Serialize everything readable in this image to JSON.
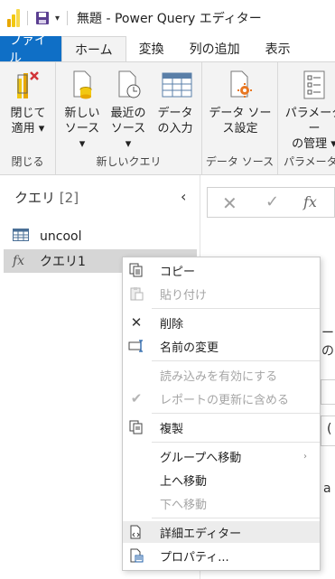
{
  "titlebar": {
    "title": "無題 - Power Query エディター",
    "quick_access_arrow": "▾"
  },
  "ribbon_tabs": [
    {
      "label": "ファイル"
    },
    {
      "label": "ホーム"
    },
    {
      "label": "変換"
    },
    {
      "label": "列の追加"
    },
    {
      "label": "表示"
    }
  ],
  "ribbon": {
    "groups": {
      "close": {
        "label": "閉じる",
        "button_line1": "閉じて",
        "button_line2": "適用 ▾"
      },
      "new_query": {
        "label": "新しいクエリ",
        "new_source_line1": "新しい",
        "new_source_line2": "ソース ▾",
        "recent_sources_line1": "最近の",
        "recent_sources_line2": "ソース ▾",
        "enter_data_line1": "データ",
        "enter_data_line2": "の入力"
      },
      "data_sources": {
        "label": "データ ソース",
        "settings_line1": "データ ソー",
        "settings_line2": "ス設定"
      },
      "parameters": {
        "label": "パラメーター",
        "manage_line1": "パラメーター",
        "manage_line2": "の管理 ▾"
      }
    }
  },
  "query_pane": {
    "header": "クエリ",
    "count": "[2]",
    "collapse_glyph": "‹",
    "items": [
      {
        "label": "uncool",
        "icon": "table-icon"
      },
      {
        "label": "クエリ1",
        "icon": "fx-icon"
      }
    ]
  },
  "formula_bar": {
    "cancel_glyph": "✕",
    "commit_glyph": "✓",
    "fx_glyph": "fx"
  },
  "background_fragments": {
    "text_a": "ーの",
    "box2_text": "(",
    "text_c": "a"
  },
  "context_menu": {
    "items": [
      {
        "label": "コピー",
        "icon": "copy-icon",
        "enabled": true
      },
      {
        "label": "貼り付け",
        "icon": "paste-icon",
        "enabled": false
      },
      {
        "label": "削除",
        "icon": "delete-icon",
        "enabled": true
      },
      {
        "label": "名前の変更",
        "icon": "rename-icon",
        "enabled": true
      },
      {
        "label": "読み込みを有効にする",
        "icon": "",
        "enabled": false
      },
      {
        "label": "レポートの更新に含める",
        "icon": "check-icon",
        "enabled": false
      },
      {
        "label": "複製",
        "icon": "duplicate-icon",
        "enabled": true
      },
      {
        "label": "グループへ移動",
        "icon": "",
        "enabled": true,
        "submenu_glyph": "›"
      },
      {
        "label": "上へ移動",
        "icon": "",
        "enabled": true
      },
      {
        "label": "下へ移動",
        "icon": "",
        "enabled": false
      },
      {
        "label": "詳細エディター",
        "icon": "advanced-editor-icon",
        "enabled": true
      },
      {
        "label": "プロパティ...",
        "icon": "properties-icon",
        "enabled": true
      }
    ]
  },
  "colors": {
    "file_tab": "#0f6fc6",
    "ribbon_bg": "#f3f3f3",
    "selected_query": "#d6d6d6",
    "disabled_text": "#a5a5a5",
    "delete_red": "#d13438",
    "settings_orange": "#e87722"
  }
}
